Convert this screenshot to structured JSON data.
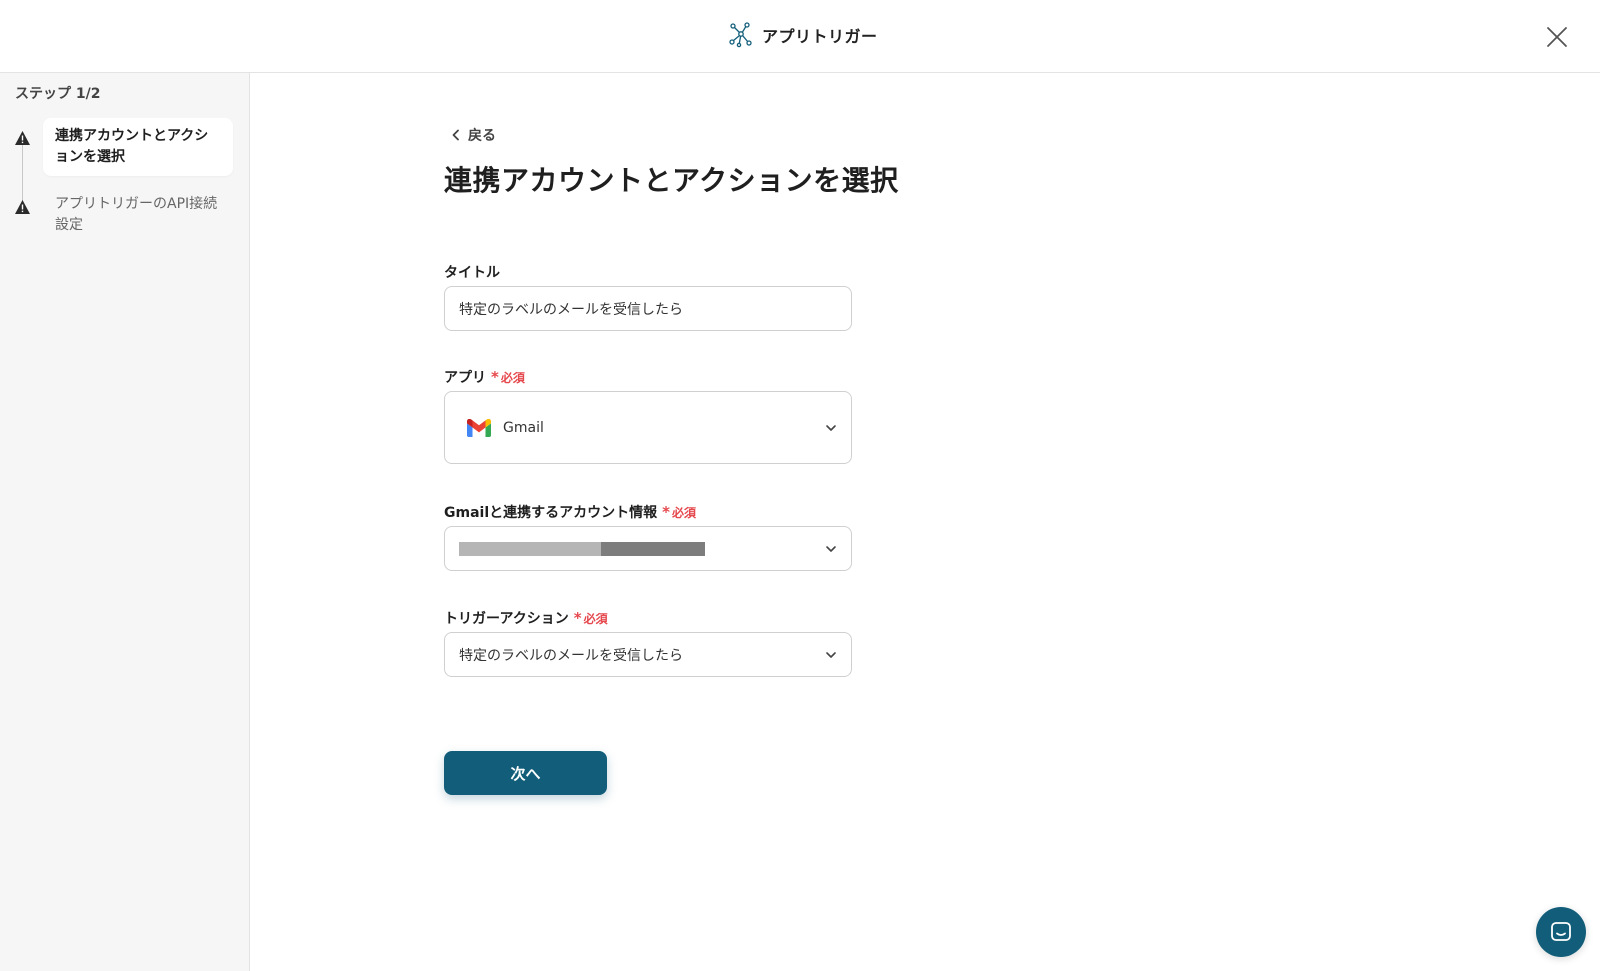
{
  "header": {
    "title": "アプリトリガー",
    "icon": "network-nodes-icon"
  },
  "sidebar": {
    "step_label": "ステップ 1/2",
    "steps": [
      {
        "label": "連携アカウントとアクションを選択",
        "status": "warning",
        "active": true
      },
      {
        "label": "アプリトリガーのAPI接続設定",
        "status": "warning",
        "active": false
      }
    ]
  },
  "main": {
    "back_label": "戻る",
    "title": "連携アカウントとアクションを選択",
    "fields": {
      "title": {
        "label": "タイトル",
        "value": "特定のラベルのメールを受信したら"
      },
      "app": {
        "label": "アプリ",
        "required_label": "必須",
        "value": "Gmail"
      },
      "account": {
        "label": "Gmailと連携するアカウント情報",
        "required_label": "必須",
        "value": ""
      },
      "trigger": {
        "label": "トリガーアクション",
        "required_label": "必須",
        "value": "特定のラベルのメールを受信したら"
      }
    },
    "next_label": "次へ"
  },
  "colors": {
    "primary": "#125e7a",
    "required": "#e5484d",
    "warning_icon": "#2b2b2b"
  }
}
